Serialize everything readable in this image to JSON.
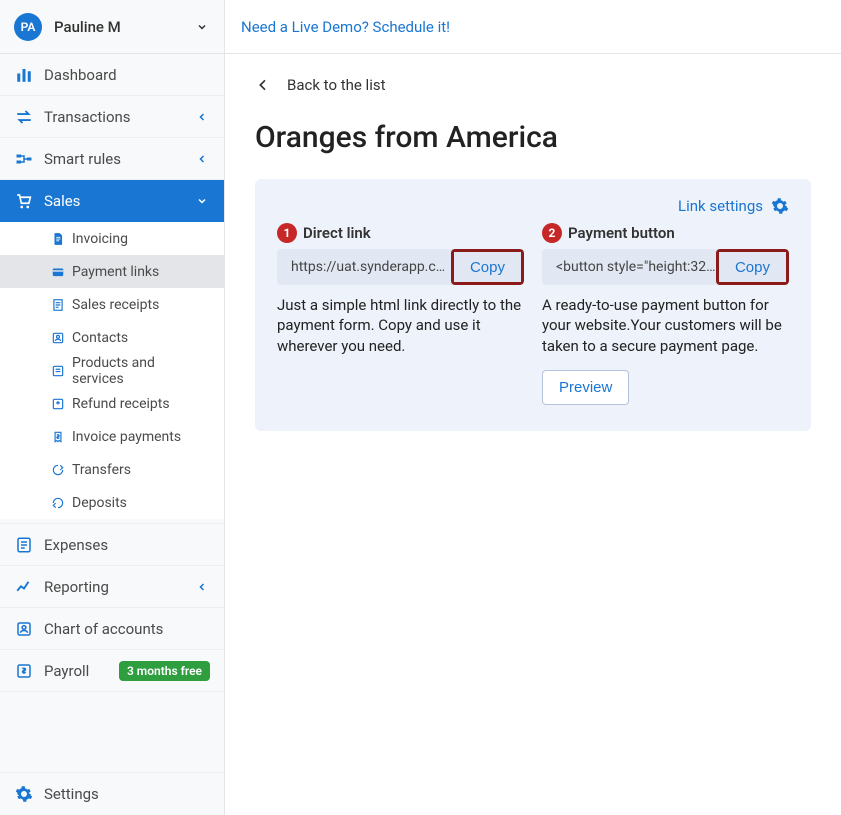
{
  "user": {
    "initials": "PA",
    "name": "Pauline M"
  },
  "topbar": {
    "demo_link": "Need a Live Demo? Schedule it!"
  },
  "nav": {
    "dashboard": "Dashboard",
    "transactions": "Transactions",
    "smart_rules": "Smart rules",
    "sales": "Sales",
    "expenses": "Expenses",
    "reporting": "Reporting",
    "chart_of_accounts": "Chart of accounts",
    "payroll": "Payroll",
    "payroll_badge": "3 months free",
    "settings": "Settings"
  },
  "sales_sub": {
    "invoicing": "Invoicing",
    "payment_links": "Payment links",
    "sales_receipts": "Sales receipts",
    "contacts": "Contacts",
    "products_services": "Products and services",
    "refund_receipts": "Refund receipts",
    "invoice_payments": "Invoice payments",
    "transfers": "Transfers",
    "deposits": "Deposits"
  },
  "page": {
    "back": "Back to the list",
    "title": "Oranges from America",
    "link_settings": "Link settings"
  },
  "direct": {
    "num": "1",
    "title": "Direct link",
    "value": "https://uat.synderapp.c…",
    "copy": "Copy",
    "desc": "Just a simple html link directly to the payment form. Copy and use it wherever you need."
  },
  "button": {
    "num": "2",
    "title": "Payment button",
    "value": "<button style=\"height:32…",
    "copy": "Copy",
    "desc": "A ready-to-use payment button for your website.Your customers will be taken to a secure payment page.",
    "preview": "Preview"
  }
}
